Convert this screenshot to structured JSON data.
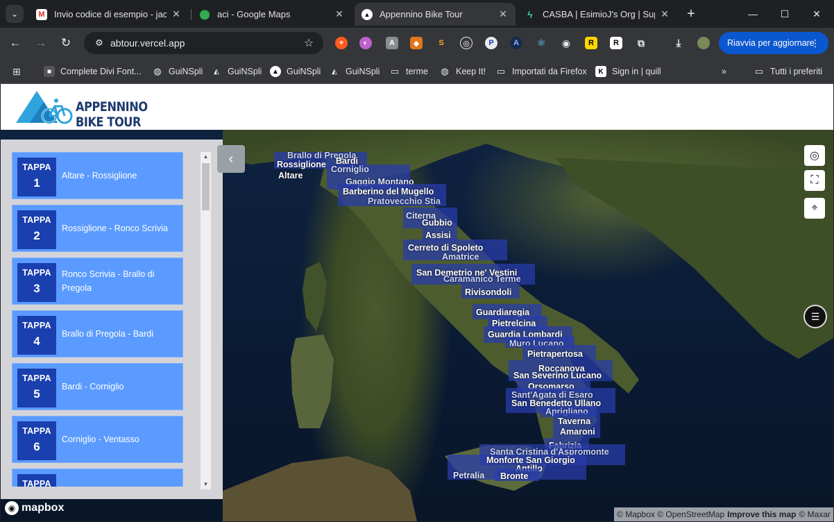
{
  "browser": {
    "tabs": [
      {
        "title": "Invio codice di esempio - jacop",
        "icon": "gmail-icon",
        "active": false
      },
      {
        "title": "aci - Google Maps",
        "icon": "google-maps-icon",
        "active": false
      },
      {
        "title": "Appennino Bike Tour",
        "icon": "vercel-icon",
        "active": true
      },
      {
        "title": "CASBA | EsimioJ's Org | Supaba",
        "icon": "supabase-icon",
        "active": false
      }
    ],
    "url": "abtour.vercel.app",
    "update_label": "Riavvia per aggiornare",
    "bookmarks": [
      {
        "label": "Complete Divi Font...",
        "icon": "site-icon"
      },
      {
        "label": "GuiNSpli",
        "icon": "globe-icon"
      },
      {
        "label": "GuiNSpli",
        "icon": "vercel-icon"
      },
      {
        "label": "GuiNSpli",
        "icon": "vercel-icon"
      },
      {
        "label": "GuiNSpli",
        "icon": "vercel-icon"
      },
      {
        "label": "terme",
        "icon": "folder-icon"
      },
      {
        "label": "Keep It!",
        "icon": "globe-icon"
      },
      {
        "label": "Importati da Firefox",
        "icon": "folder-icon"
      },
      {
        "label": "Sign in | quill",
        "icon": "site-icon"
      }
    ],
    "all_bookmarks_label": "Tutti i preferiti"
  },
  "site": {
    "logo_line1": "APPENNINO",
    "logo_line2": "BIKE TOUR"
  },
  "stages": [
    {
      "label": "TAPPA",
      "number": "1",
      "route": "Altare - Rossiglione"
    },
    {
      "label": "TAPPA",
      "number": "2",
      "route": "Rossiglione - Ronco Scrivia"
    },
    {
      "label": "TAPPA",
      "number": "3",
      "route": "Ronco Scrivia - Brallo di Pregola"
    },
    {
      "label": "TAPPA",
      "number": "4",
      "route": "Brallo di Pregola - Bardi"
    },
    {
      "label": "TAPPA",
      "number": "5",
      "route": "Bardi - Corniglio"
    },
    {
      "label": "TAPPA",
      "number": "6",
      "route": "Corniglio - Ventasso"
    },
    {
      "label": "TAPPA",
      "number": "",
      "route": ""
    }
  ],
  "map_labels": [
    "Brallo di Pregola",
    "Rossiglione",
    "Bardi",
    "Altare",
    "Corniglio",
    "Gaggio Montano",
    "Barberino del Mugello",
    "Pratovecchio Stia",
    "Citerna",
    "Gubbio",
    "Assisi",
    "Cerreto di Spoleto",
    "Amatrice",
    "San Demetrio ne' Vestini",
    "Caramanico Terme",
    "Rivisondoli",
    "Guardiaregia",
    "Pietrelcina",
    "Guardia Lombardi",
    "Muro Lucano",
    "Pietrapertosa",
    "Roccanova",
    "San Severino Lucano",
    "Orsomarso",
    "Sant'Agata di Esaro",
    "San Benedetto Ullano",
    "Aprigliano",
    "Taverna",
    "Amaroni",
    "Fabrizia",
    "Santa Cristina d'Aspromonte",
    "Monforte San Giorgio",
    "Antillo",
    "Bronte",
    "Petralia"
  ],
  "map": {
    "brand": "mapbox",
    "attribution": {
      "part1": "© Mapbox © OpenStreetMap",
      "improve": "Improve this map",
      "part2": "© Maxar"
    }
  }
}
